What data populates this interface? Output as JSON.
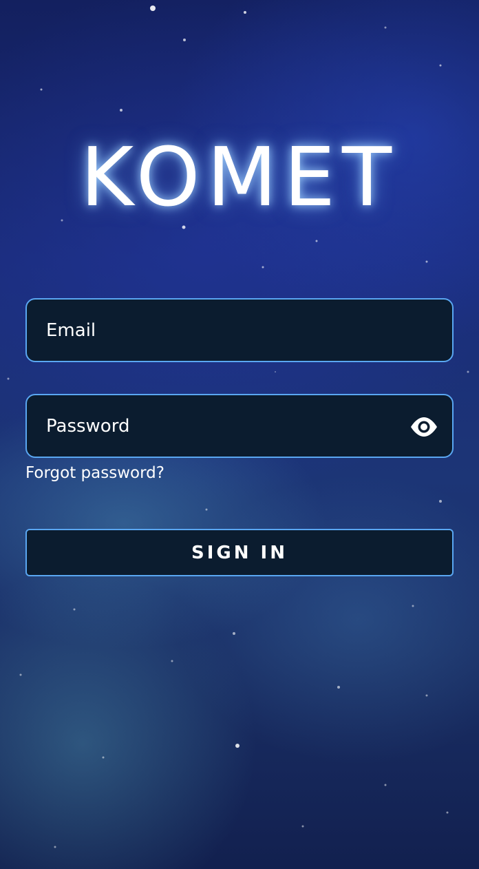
{
  "app": {
    "logo_text": "KOMET"
  },
  "form": {
    "email": {
      "placeholder": "Email",
      "value": ""
    },
    "password": {
      "placeholder": "Password",
      "value": "",
      "toggle_icon": "eye-icon"
    },
    "forgot_label": "Forgot password?",
    "submit_label": "SIGN IN"
  },
  "colors": {
    "field_background": "#0b1c2f",
    "field_border": "#5aa7f2",
    "text": "#ffffff",
    "glow": "#a0d2ff"
  }
}
